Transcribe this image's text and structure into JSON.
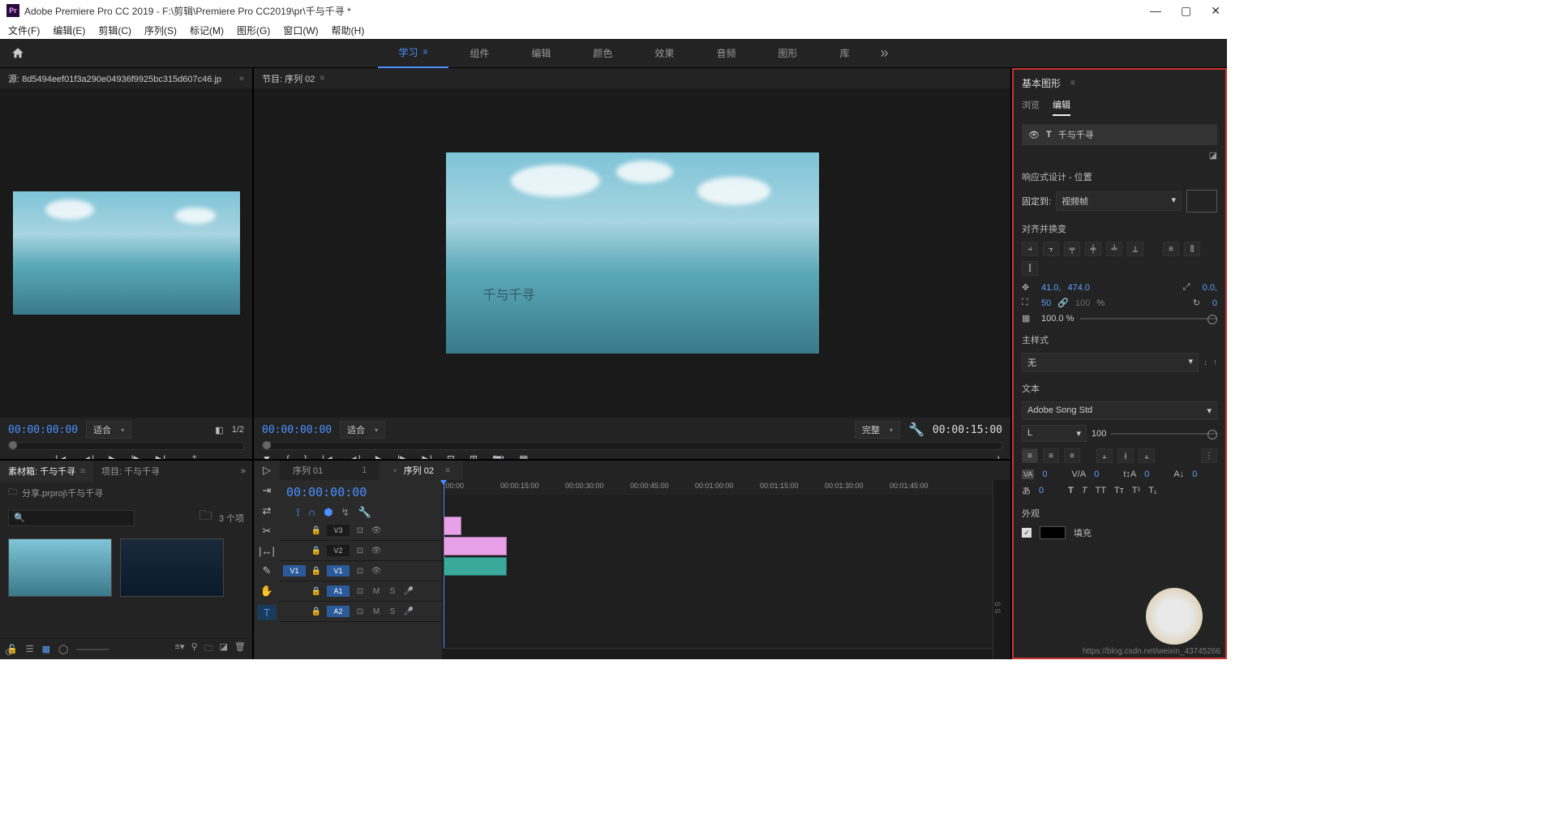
{
  "titlebar": {
    "app_icon": "Pr",
    "title": "Adobe Premiere Pro CC 2019 - F:\\剪辑\\Premiere Pro CC2019\\pr\\千与千寻 *"
  },
  "menubar": [
    "文件(F)",
    "编辑(E)",
    "剪辑(C)",
    "序列(S)",
    "标记(M)",
    "图形(G)",
    "窗口(W)",
    "帮助(H)"
  ],
  "workspaces": {
    "items": [
      "学习",
      "组件",
      "编辑",
      "颜色",
      "效果",
      "音频",
      "图形",
      "库"
    ],
    "active": "学习"
  },
  "source": {
    "title": "源: 8d5494eef01f3a290e04936f9925bc315d607c46.jp",
    "timecode": "00:00:00:00",
    "fit": "适合",
    "page": "1/2"
  },
  "program": {
    "title": "节目: 序列 02",
    "overlay_text": "千与千寻",
    "timecode": "00:00:00:00",
    "fit": "适合",
    "quality": "完整",
    "duration": "00:00:15:00"
  },
  "project": {
    "tabs": [
      "素材箱: 千与千寻",
      "项目: 千与千寻"
    ],
    "active_tab": 0,
    "path": "分享.prproj\\千与千寻",
    "count": "3 个项",
    "search_placeholder": ""
  },
  "timeline": {
    "seq_tabs": [
      {
        "label": "序列 01",
        "num": "1"
      },
      {
        "label": "序列 02"
      }
    ],
    "active_seq": 1,
    "timecode": "00:00:00:00",
    "ruler": [
      ":00:00",
      "00:00:15:00",
      "00:00:30:00",
      "00:00:45:00",
      "00:01:00:00",
      "00:01:15:00",
      "00:01:30:00",
      "00:01:45:00"
    ],
    "video_tracks": [
      "V3",
      "V2",
      "V1"
    ],
    "audio_tracks": [
      "A1",
      "A2"
    ],
    "meter_label": "S S"
  },
  "essential_graphics": {
    "title": "基本图形",
    "tabs": [
      "浏览",
      "编辑"
    ],
    "active_tab": 1,
    "layer_name": "千与千寻",
    "responsive_title": "响应式设计 - 位置",
    "pin_label": "固定到:",
    "pin_value": "视频帧",
    "align_title": "对齐并换变",
    "pos_x": "41.0,",
    "pos_y": "474.0",
    "anchor_x": "0.0,",
    "anchor_y": "",
    "scale": "50",
    "scale_h": "100",
    "scale_unit": "%",
    "rotation": "0",
    "opacity": "100.0 %",
    "master_style_title": "主样式",
    "master_style_value": "无",
    "text_title": "文本",
    "font": "Adobe Song Std",
    "font_style": "L",
    "font_size": "100",
    "tracking": "0",
    "kerning": "0",
    "leading": "0",
    "baseline": "0",
    "tsume": "0",
    "appearance_title": "外观",
    "fill_label": "填充"
  },
  "watermark": "https://blog.csdn.net/weixin_43745266"
}
